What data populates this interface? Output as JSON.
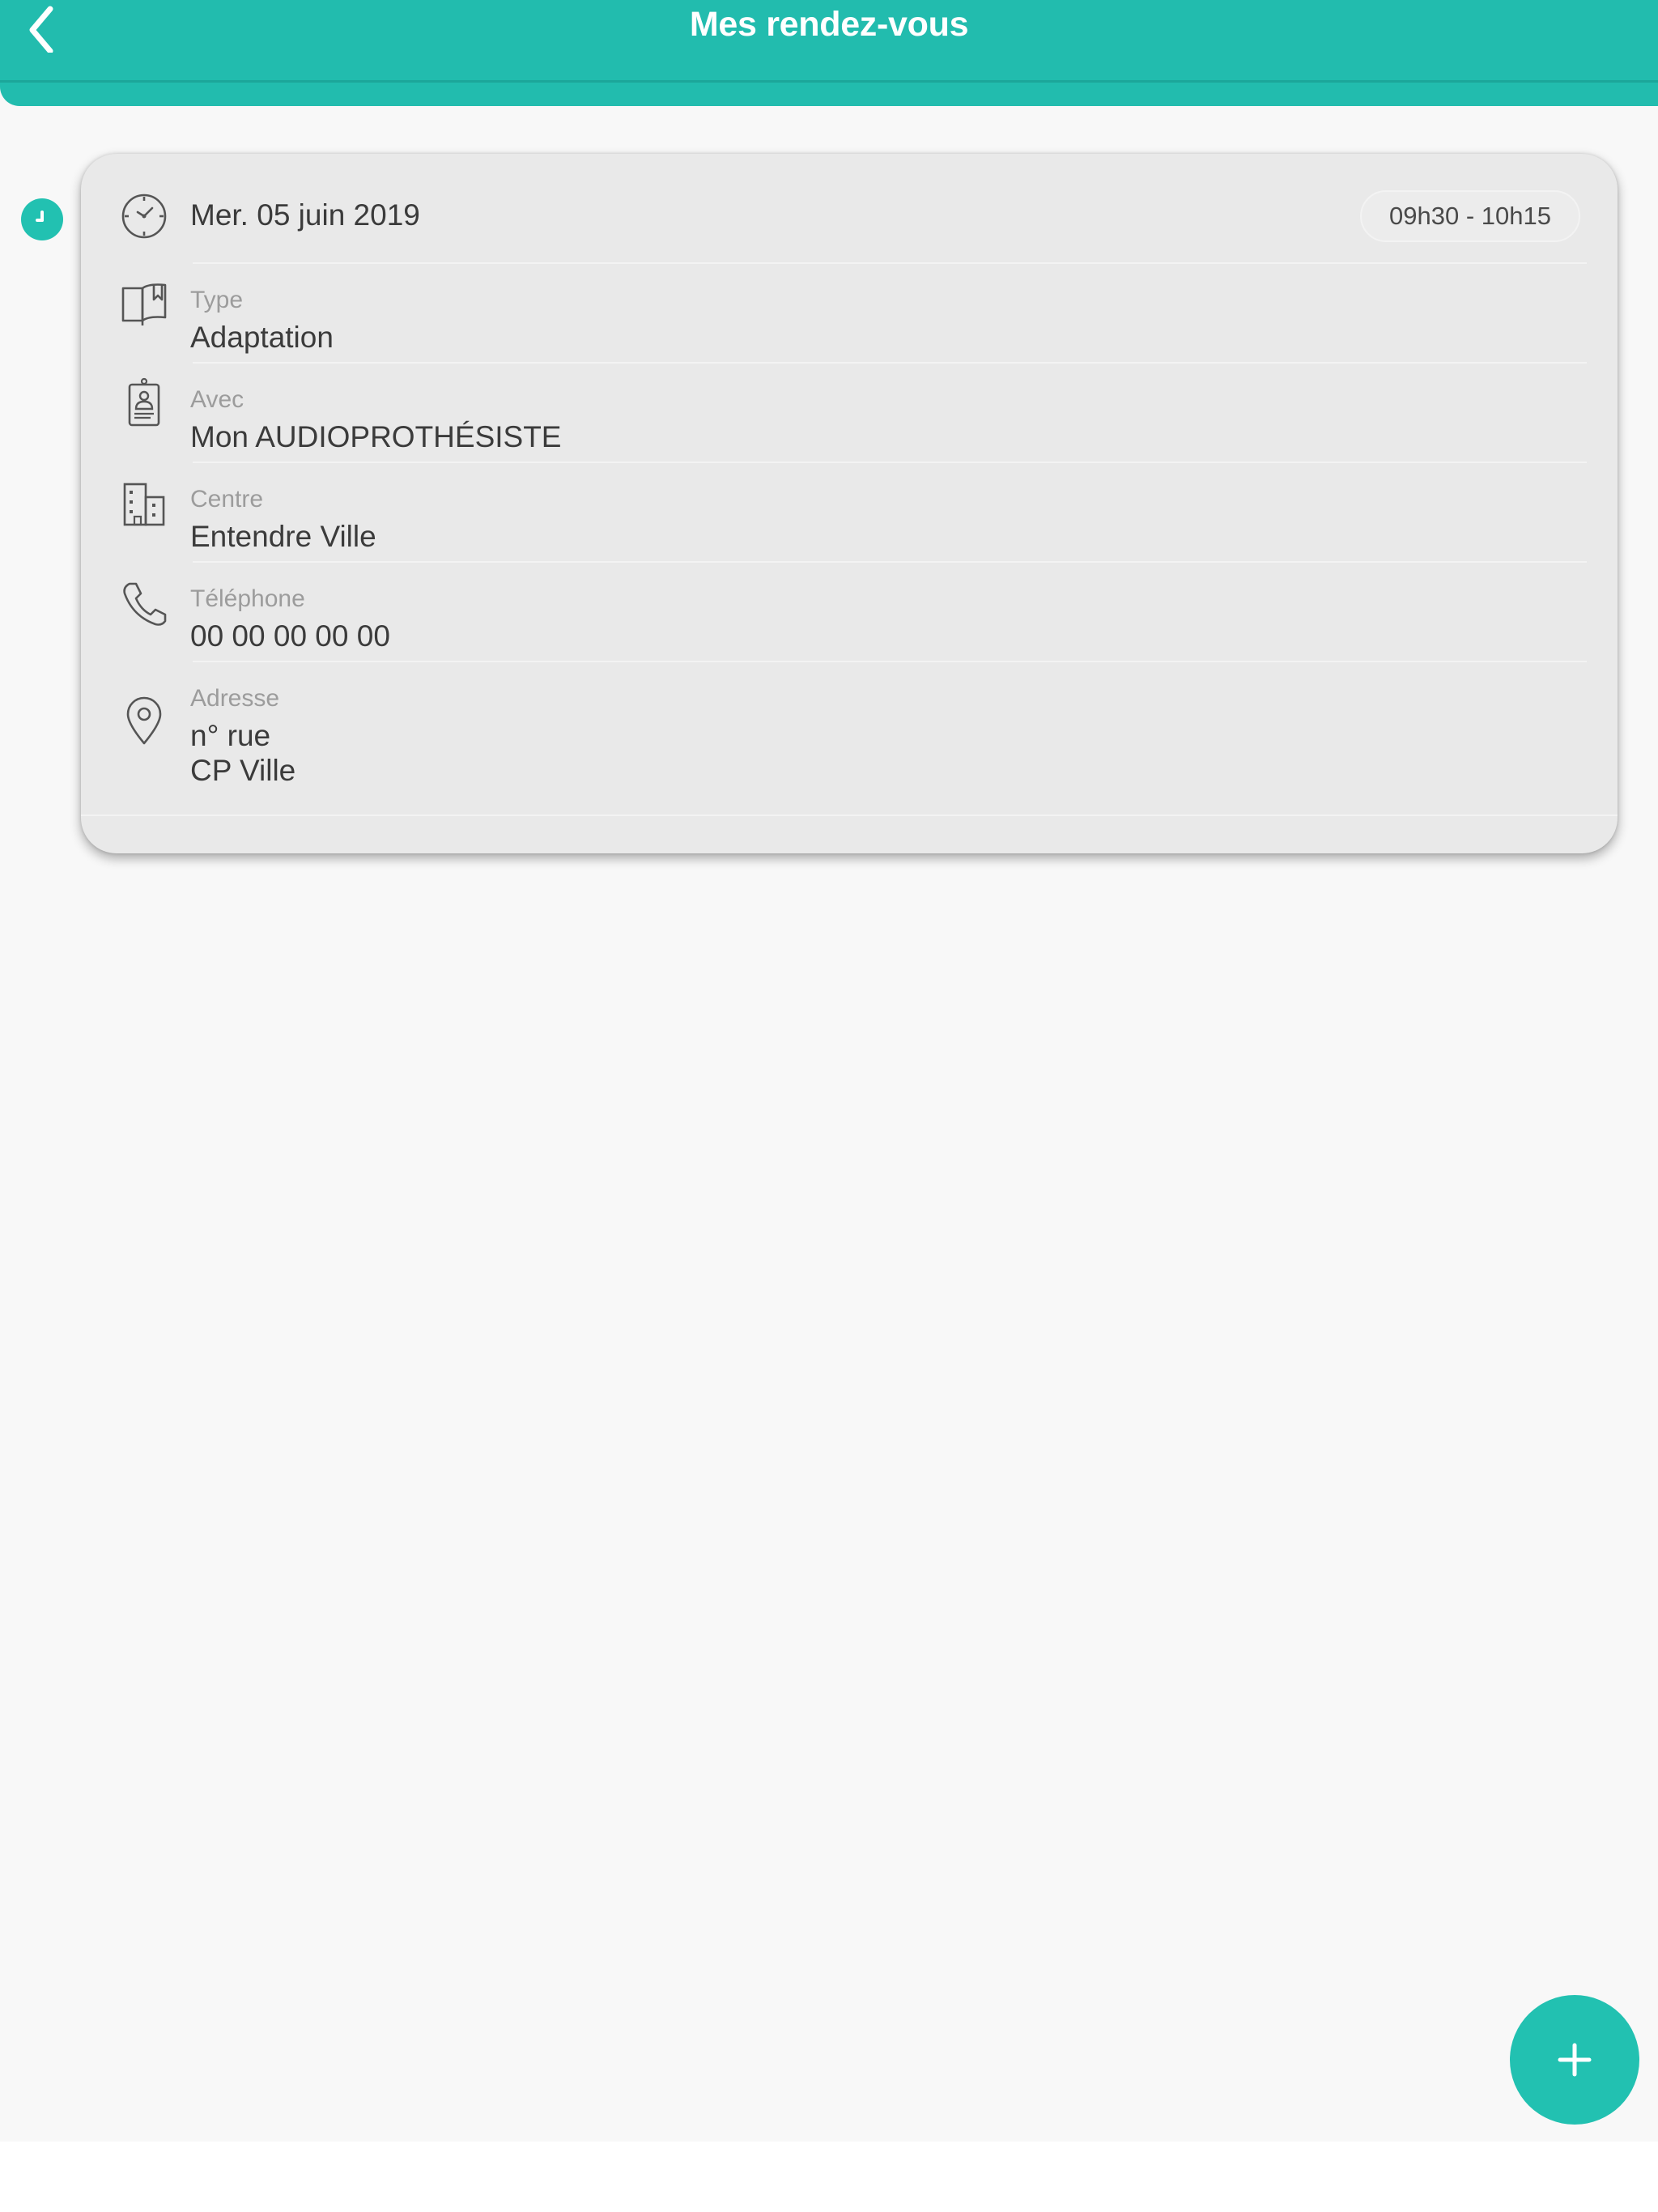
{
  "header": {
    "title": "Mes rendez-vous",
    "back_icon": "chevron-left-icon",
    "background_color": "#22bcae"
  },
  "appointment": {
    "date": "Mer. 05 juin 2019",
    "time_range": "09h30 - 10h15",
    "type": {
      "label": "Type",
      "value": "Adaptation",
      "icon": "book-icon"
    },
    "with": {
      "label": "Avec",
      "value": "Mon AUDIOPROTHÉSISTE",
      "icon": "badge-icon"
    },
    "center": {
      "label": "Centre",
      "value": "Entendre Ville",
      "icon": "building-icon"
    },
    "phone": {
      "label": "Téléphone",
      "value": "00 00 00 00 00",
      "icon": "phone-icon"
    },
    "address": {
      "label": "Adresse",
      "line1": "n° rue",
      "line2": "CP  Ville",
      "icon": "location-pin-icon"
    }
  },
  "fab": {
    "label": "+",
    "icon": "plus-icon",
    "color": "#22c1b1"
  },
  "colors": {
    "accent": "#22bcae",
    "card": "#e9e9e9",
    "background": "#f8f8f8"
  }
}
